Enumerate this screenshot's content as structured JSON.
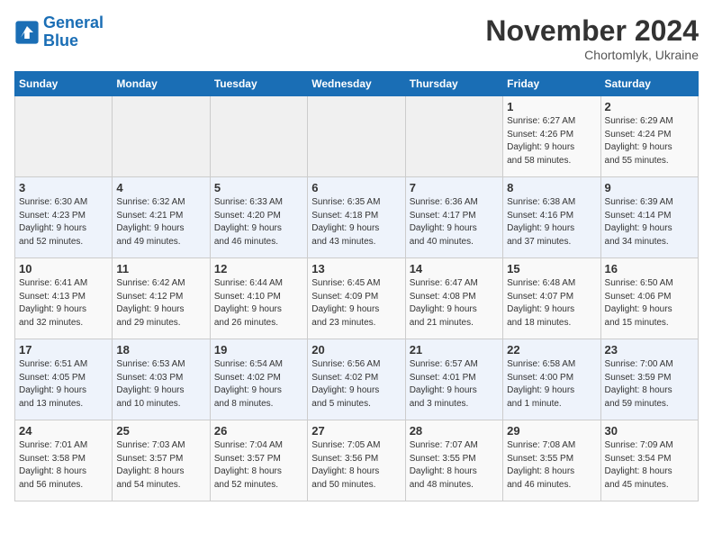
{
  "logo": {
    "line1": "General",
    "line2": "Blue"
  },
  "title": "November 2024",
  "subtitle": "Chortomlyk, Ukraine",
  "days_of_week": [
    "Sunday",
    "Monday",
    "Tuesday",
    "Wednesday",
    "Thursday",
    "Friday",
    "Saturday"
  ],
  "weeks": [
    [
      {
        "day": "",
        "info": ""
      },
      {
        "day": "",
        "info": ""
      },
      {
        "day": "",
        "info": ""
      },
      {
        "day": "",
        "info": ""
      },
      {
        "day": "",
        "info": ""
      },
      {
        "day": "1",
        "info": "Sunrise: 6:27 AM\nSunset: 4:26 PM\nDaylight: 9 hours\nand 58 minutes."
      },
      {
        "day": "2",
        "info": "Sunrise: 6:29 AM\nSunset: 4:24 PM\nDaylight: 9 hours\nand 55 minutes."
      }
    ],
    [
      {
        "day": "3",
        "info": "Sunrise: 6:30 AM\nSunset: 4:23 PM\nDaylight: 9 hours\nand 52 minutes."
      },
      {
        "day": "4",
        "info": "Sunrise: 6:32 AM\nSunset: 4:21 PM\nDaylight: 9 hours\nand 49 minutes."
      },
      {
        "day": "5",
        "info": "Sunrise: 6:33 AM\nSunset: 4:20 PM\nDaylight: 9 hours\nand 46 minutes."
      },
      {
        "day": "6",
        "info": "Sunrise: 6:35 AM\nSunset: 4:18 PM\nDaylight: 9 hours\nand 43 minutes."
      },
      {
        "day": "7",
        "info": "Sunrise: 6:36 AM\nSunset: 4:17 PM\nDaylight: 9 hours\nand 40 minutes."
      },
      {
        "day": "8",
        "info": "Sunrise: 6:38 AM\nSunset: 4:16 PM\nDaylight: 9 hours\nand 37 minutes."
      },
      {
        "day": "9",
        "info": "Sunrise: 6:39 AM\nSunset: 4:14 PM\nDaylight: 9 hours\nand 34 minutes."
      }
    ],
    [
      {
        "day": "10",
        "info": "Sunrise: 6:41 AM\nSunset: 4:13 PM\nDaylight: 9 hours\nand 32 minutes."
      },
      {
        "day": "11",
        "info": "Sunrise: 6:42 AM\nSunset: 4:12 PM\nDaylight: 9 hours\nand 29 minutes."
      },
      {
        "day": "12",
        "info": "Sunrise: 6:44 AM\nSunset: 4:10 PM\nDaylight: 9 hours\nand 26 minutes."
      },
      {
        "day": "13",
        "info": "Sunrise: 6:45 AM\nSunset: 4:09 PM\nDaylight: 9 hours\nand 23 minutes."
      },
      {
        "day": "14",
        "info": "Sunrise: 6:47 AM\nSunset: 4:08 PM\nDaylight: 9 hours\nand 21 minutes."
      },
      {
        "day": "15",
        "info": "Sunrise: 6:48 AM\nSunset: 4:07 PM\nDaylight: 9 hours\nand 18 minutes."
      },
      {
        "day": "16",
        "info": "Sunrise: 6:50 AM\nSunset: 4:06 PM\nDaylight: 9 hours\nand 15 minutes."
      }
    ],
    [
      {
        "day": "17",
        "info": "Sunrise: 6:51 AM\nSunset: 4:05 PM\nDaylight: 9 hours\nand 13 minutes."
      },
      {
        "day": "18",
        "info": "Sunrise: 6:53 AM\nSunset: 4:03 PM\nDaylight: 9 hours\nand 10 minutes."
      },
      {
        "day": "19",
        "info": "Sunrise: 6:54 AM\nSunset: 4:02 PM\nDaylight: 9 hours\nand 8 minutes."
      },
      {
        "day": "20",
        "info": "Sunrise: 6:56 AM\nSunset: 4:02 PM\nDaylight: 9 hours\nand 5 minutes."
      },
      {
        "day": "21",
        "info": "Sunrise: 6:57 AM\nSunset: 4:01 PM\nDaylight: 9 hours\nand 3 minutes."
      },
      {
        "day": "22",
        "info": "Sunrise: 6:58 AM\nSunset: 4:00 PM\nDaylight: 9 hours\nand 1 minute."
      },
      {
        "day": "23",
        "info": "Sunrise: 7:00 AM\nSunset: 3:59 PM\nDaylight: 8 hours\nand 59 minutes."
      }
    ],
    [
      {
        "day": "24",
        "info": "Sunrise: 7:01 AM\nSunset: 3:58 PM\nDaylight: 8 hours\nand 56 minutes."
      },
      {
        "day": "25",
        "info": "Sunrise: 7:03 AM\nSunset: 3:57 PM\nDaylight: 8 hours\nand 54 minutes."
      },
      {
        "day": "26",
        "info": "Sunrise: 7:04 AM\nSunset: 3:57 PM\nDaylight: 8 hours\nand 52 minutes."
      },
      {
        "day": "27",
        "info": "Sunrise: 7:05 AM\nSunset: 3:56 PM\nDaylight: 8 hours\nand 50 minutes."
      },
      {
        "day": "28",
        "info": "Sunrise: 7:07 AM\nSunset: 3:55 PM\nDaylight: 8 hours\nand 48 minutes."
      },
      {
        "day": "29",
        "info": "Sunrise: 7:08 AM\nSunset: 3:55 PM\nDaylight: 8 hours\nand 46 minutes."
      },
      {
        "day": "30",
        "info": "Sunrise: 7:09 AM\nSunset: 3:54 PM\nDaylight: 8 hours\nand 45 minutes."
      }
    ]
  ]
}
